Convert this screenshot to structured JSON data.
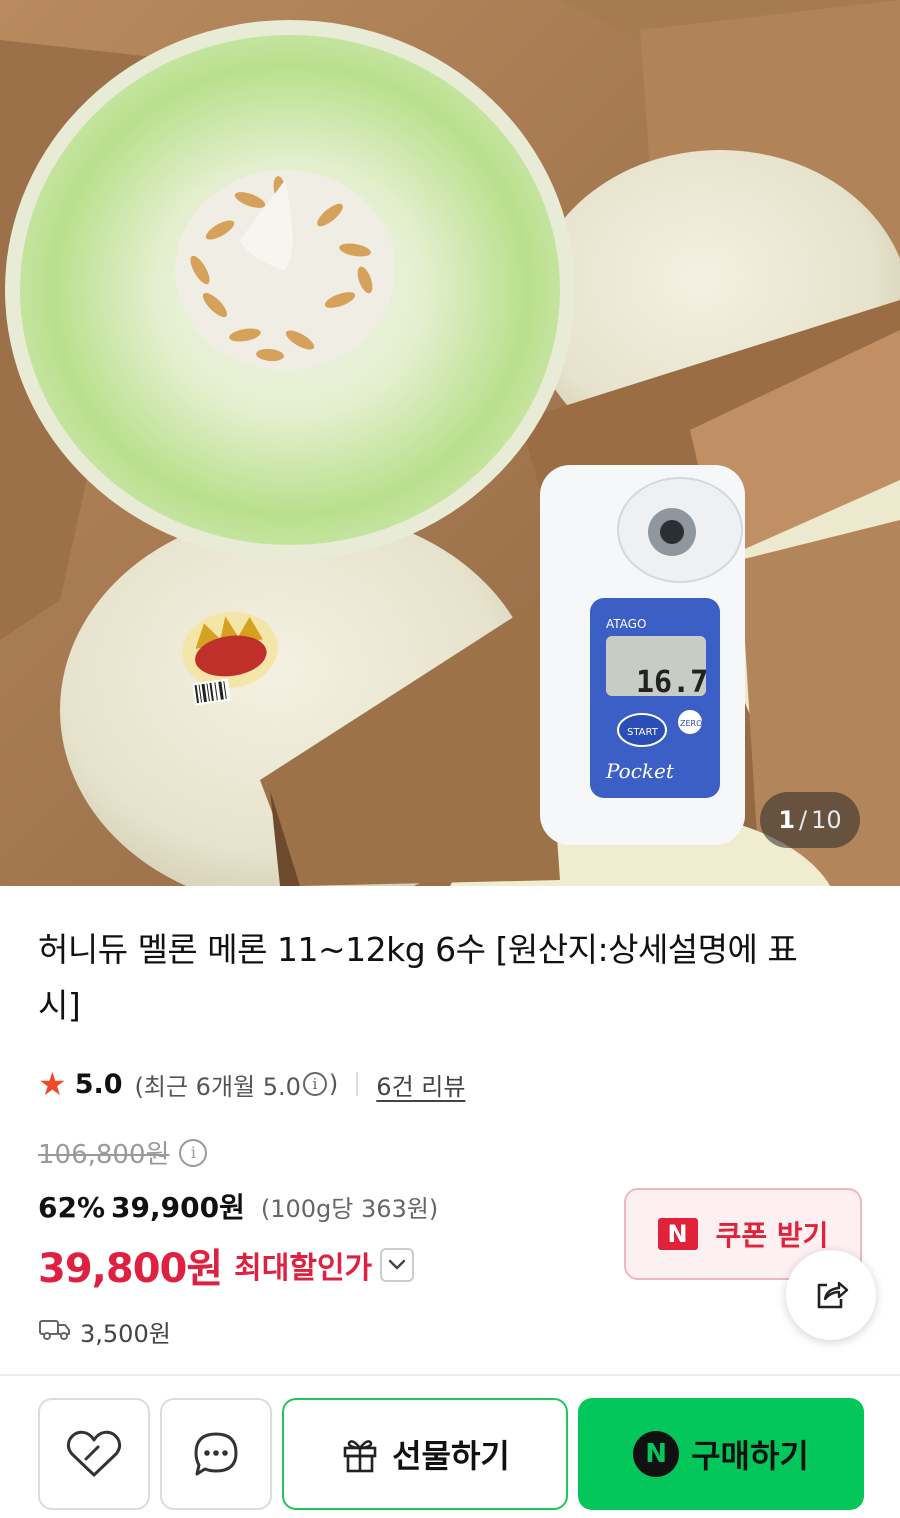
{
  "gallery": {
    "current": "1",
    "separator": "/",
    "total": "10",
    "refractometer_reading": "16.7",
    "refractometer_brand": "ATAGO",
    "refractometer_start": "START",
    "refractometer_zero": "ZERO",
    "refractometer_model": "Pocket"
  },
  "product": {
    "title": "허니듀 멜론 메론 11~12kg 6수 [원산지:상세설명에 표시]",
    "rating": {
      "score": "5.0",
      "recent": "(최근 6개월 5.0",
      "recent_close": ")",
      "reviews": "6건 리뷰"
    },
    "original_price": "106,800원",
    "discount_percent": "62%",
    "sale_price": "39,900원",
    "unit_price": "(100g당 363원)",
    "final_price": "39,800원",
    "final_label": "최대할인가",
    "shipping": "3,500원"
  },
  "coupon": {
    "badge": "N",
    "label": "쿠폰 받기"
  },
  "actions": {
    "gift_label": "선물하기",
    "buy_badge": "N",
    "buy_label": "구매하기"
  },
  "colors": {
    "accent_red": "#e02040",
    "naver_green": "#03c75a",
    "star": "#f04a2a"
  },
  "icons": [
    "star-icon",
    "info-icon",
    "chevron-down-icon",
    "delivery-truck-icon",
    "share-icon",
    "heart-icon",
    "chat-icon",
    "gift-icon"
  ]
}
